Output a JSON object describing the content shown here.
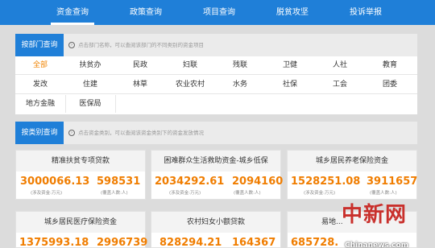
{
  "nav": {
    "items": [
      "资金查询",
      "政策查询",
      "项目查询",
      "脱贫攻坚",
      "投诉举报"
    ],
    "active_index": 0
  },
  "dept_panel": {
    "tag": "按部门查询",
    "hint": "点击部门名称，可以查阅该部门的不同类别的资金项目",
    "rows": [
      [
        "全部",
        "扶贫办",
        "民政",
        "妇联",
        "残联",
        "卫健",
        "人社",
        "教育"
      ],
      [
        "发改",
        "住建",
        "林草",
        "农业农村",
        "水务",
        "社保",
        "工会",
        "团委"
      ],
      [
        "地方金融",
        "医保局"
      ]
    ],
    "active": "全部"
  },
  "cat_panel": {
    "tag": "按类别查询",
    "hint": "点击资金类别，可以查阅该资金类别下的资金发放情况"
  },
  "cards": [
    {
      "title": "精准扶贫专项贷款",
      "v1": "3000066.13",
      "s1": "(涉及资金:万元)",
      "v2": "598531",
      "s2": "(覆盖人数:人)"
    },
    {
      "title": "困难群众生活救助资金-城乡低保",
      "v1": "2034292.61",
      "s1": "(涉及资金:万元)",
      "v2": "2094160",
      "s2": "(覆盖人数:人)"
    },
    {
      "title": "城乡居民养老保险资金",
      "v1": "1528251.08",
      "s1": "(涉及资金:万元)",
      "v2": "3911657",
      "s2": "(覆盖人数:人)"
    },
    {
      "title": "城乡居民医疗保险资金",
      "v1": "1375993.18",
      "s1": "",
      "v2": "2996739",
      "s2": ""
    },
    {
      "title": "农村妇女小额贷款",
      "v1": "828294.21",
      "s1": "",
      "v2": "164367",
      "s2": ""
    },
    {
      "title": "易地...",
      "v1": "685728.",
      "s1": "",
      "v2": "",
      "s2": ""
    }
  ],
  "watermark": {
    "text": "中新网",
    "url": "Chinanews.com"
  },
  "colors": {
    "nav": "#1f7fd8",
    "accent": "#f07d00"
  }
}
